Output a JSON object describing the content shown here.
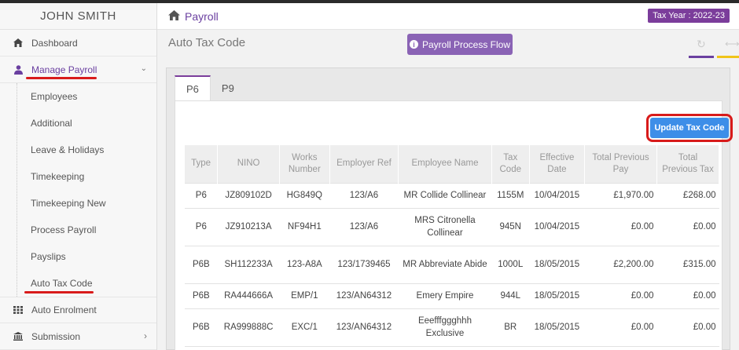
{
  "user": {
    "name": "JOHN SMITH"
  },
  "sidebar": {
    "items": [
      {
        "label": "Dashboard",
        "icon": "dashboard-icon"
      },
      {
        "label": "Manage Payroll",
        "icon": "user-icon"
      },
      {
        "label": "Auto Enrolment",
        "icon": "grid-icon"
      },
      {
        "label": "Submission",
        "icon": "bank-icon"
      }
    ],
    "sub": [
      "Employees",
      "Additional",
      "Leave & Holidays",
      "Timekeeping",
      "Timekeeping New",
      "Process Payroll",
      "Payslips",
      "Auto Tax Code"
    ]
  },
  "header": {
    "title": "Payroll",
    "tax_year": "Tax Year : 2022-23"
  },
  "page": {
    "title": "Auto Tax Code",
    "flow_button": "Payroll Process Flow"
  },
  "tabs": [
    "P6",
    "P9"
  ],
  "update_button": "Update Tax Code",
  "colors": {
    "accent": "#6a3fa0",
    "button_blue": "#3d8ee8",
    "annotation_red": "#d81b1b"
  },
  "table": {
    "headers": [
      "Type",
      "NINO",
      "Works Number",
      "Employer Ref",
      "Employee Name",
      "Tax Code",
      "Effective Date",
      "Total Previous Pay",
      "Total Previous Tax"
    ],
    "rows": [
      [
        "P6",
        "JZ809102D",
        "HG849Q",
        "123/A6",
        "MR Collide Collinear",
        "1155M",
        "10/04/2015",
        "£1,970.00",
        "£268.00"
      ],
      [
        "P6",
        "JZ910213A",
        "NF94H1",
        "123/A6",
        "MRS Citronella Collinear",
        "945N",
        "10/04/2015",
        "£0.00",
        "£0.00"
      ],
      [
        "P6B",
        "SH112233A",
        "123-A8A",
        "123/1739465",
        "MR Abbreviate Abide",
        "1000L",
        "18/05/2015",
        "£2,200.00",
        "£315.00"
      ],
      [
        "P6B",
        "RA444666A",
        "EMP/1",
        "123/AN64312",
        "Emery Empire",
        "944L",
        "18/05/2015",
        "£0.00",
        "£0.00"
      ],
      [
        "P6B",
        "RA999888C",
        "EXC/1",
        "123/AN64312",
        "Eeefffggghhh Exclusive",
        "BR",
        "18/05/2015",
        "£0.00",
        "£0.00"
      ]
    ]
  }
}
